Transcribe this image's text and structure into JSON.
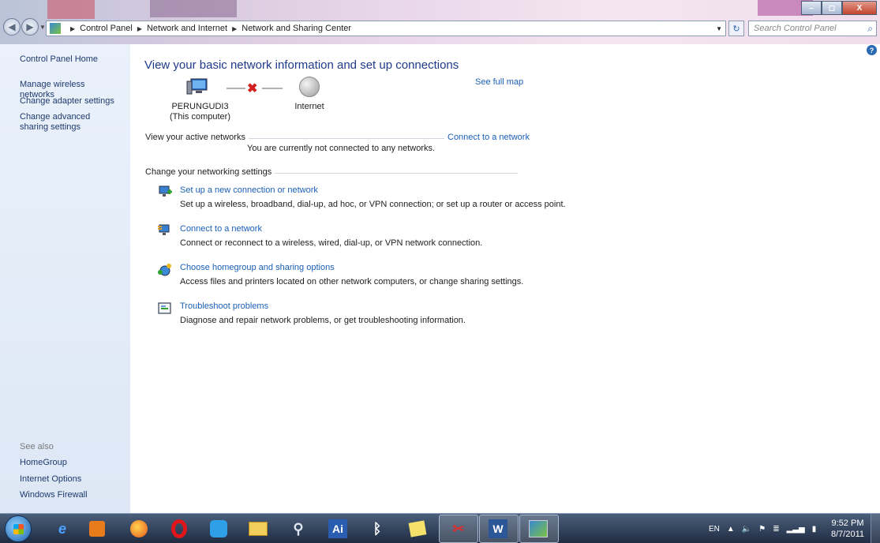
{
  "window": {
    "minimize": "–",
    "maximize": "◻",
    "close": "X"
  },
  "address": {
    "crumbs": [
      "Control Panel",
      "Network and Internet",
      "Network and Sharing Center"
    ]
  },
  "search": {
    "placeholder": "Search Control Panel"
  },
  "sidebar": {
    "home": "Control Panel Home",
    "items": [
      {
        "label": "Manage wireless networks"
      },
      {
        "label": "Change adapter settings"
      },
      {
        "label": "Change advanced sharing settings"
      }
    ],
    "see_also": "See also",
    "see_also_items": [
      {
        "label": "HomeGroup"
      },
      {
        "label": "Internet Options"
      },
      {
        "label": "Windows Firewall"
      }
    ]
  },
  "main": {
    "title": "View your basic network information and set up connections",
    "see_full_map": "See full map",
    "computer_name": "PERUNGUDI3",
    "computer_sub": "(This computer)",
    "internet_label": "Internet",
    "active_networks_label": "View your active networks",
    "connect_link": "Connect to a network",
    "not_connected": "You are currently not connected to any networks.",
    "settings_label": "Change your networking settings",
    "tasks": [
      {
        "title": "Set up a new connection or network",
        "desc": "Set up a wireless, broadband, dial-up, ad hoc, or VPN connection; or set up a router or access point."
      },
      {
        "title": "Connect to a network",
        "desc": "Connect or reconnect to a wireless, wired, dial-up, or VPN network connection."
      },
      {
        "title": "Choose homegroup and sharing options",
        "desc": "Access files and printers located on other network computers, or change sharing settings."
      },
      {
        "title": "Troubleshoot problems",
        "desc": "Diagnose and repair network problems, or get troubleshooting information."
      }
    ]
  },
  "taskbar": {
    "language": "EN",
    "time": "9:52 PM",
    "date": "8/7/2011"
  },
  "colors": {
    "link": "#1b5fb7",
    "title": "#1e3a8a",
    "sidebar_bg": "#e3ecf8",
    "error_x": "#d21f1f"
  }
}
